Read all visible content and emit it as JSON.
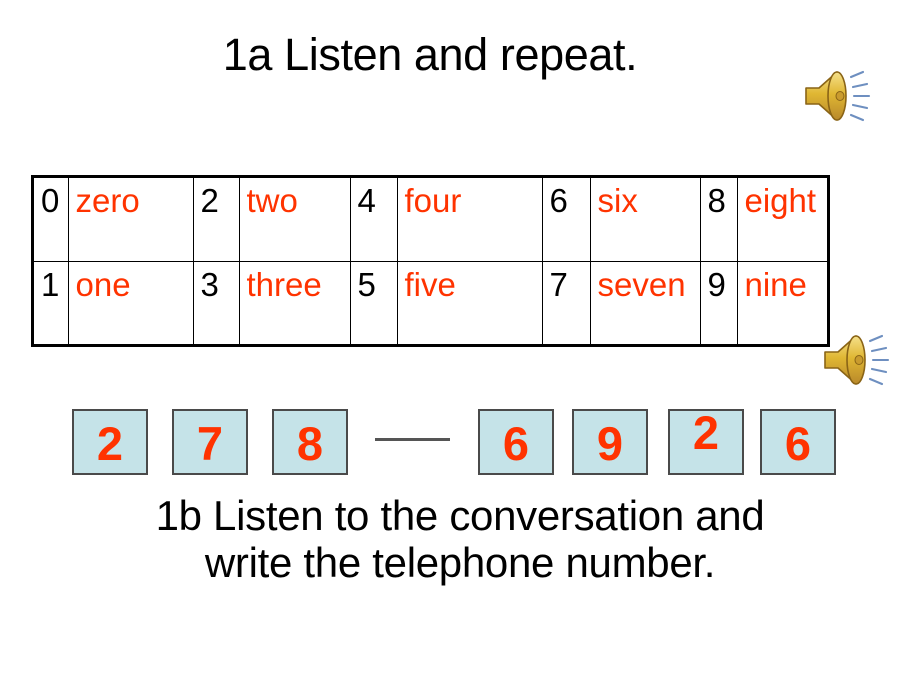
{
  "slide": {
    "title": "1a Listen and repeat.",
    "caption_line_1": "1b Listen to the conversation and",
    "caption_line_2": "write the telephone number.",
    "colors": {
      "word_red": "#FF3300",
      "digit_black": "#000000",
      "box_fill": "#C5E3E8",
      "box_border": "#4A4A4A",
      "dash": "#555555"
    }
  },
  "audio_icons": [
    {
      "name": "speaker-icon-top",
      "label": "sound"
    },
    {
      "name": "speaker-icon-middle",
      "label": "sound"
    }
  ],
  "number_table": {
    "rows": [
      {
        "cells": [
          {
            "digit": "0",
            "word": "zero"
          },
          {
            "digit": "2",
            "word": "two"
          },
          {
            "digit": "4",
            "word": "four"
          },
          {
            "digit": "6",
            "word": "six"
          },
          {
            "digit": "8",
            "word": "eight"
          }
        ]
      },
      {
        "cells": [
          {
            "digit": "1",
            "word": "one"
          },
          {
            "digit": "3",
            "word": "three"
          },
          {
            "digit": "5",
            "word": "five"
          },
          {
            "digit": "7",
            "word": "seven"
          },
          {
            "digit": "9",
            "word": "nine"
          }
        ]
      }
    ]
  },
  "phone_number": {
    "full": "278-6926",
    "left_group": [
      "2",
      "7",
      "8"
    ],
    "separator": "—",
    "right_group": [
      "6",
      "9",
      "2",
      "6"
    ]
  }
}
